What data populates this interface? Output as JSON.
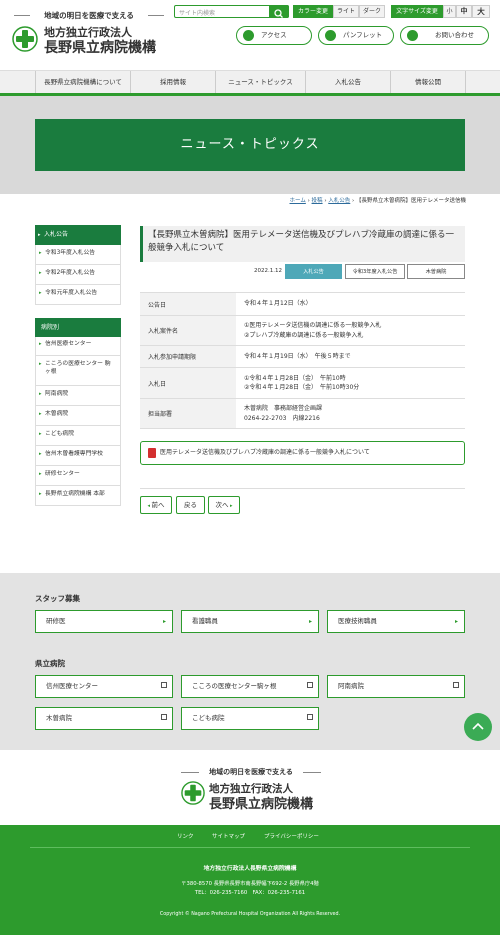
{
  "header": {
    "tagline": "地域の明日を医療で支える",
    "org_line1": "地方独立行政法人",
    "org_line2": "長野県立病院機構",
    "search_placeholder": "サイト内検索",
    "color_label": "カラー変更",
    "color_light": "ライト",
    "color_dark": "ダーク",
    "fontsize_label": "文字サイズ変更",
    "font_small": "小",
    "font_medium": "中",
    "font_large": "大",
    "access": "アクセス",
    "pamphlet": "パンフレット",
    "contact": "お問い合わせ"
  },
  "nav": [
    "長野県立病院機構について",
    "採用情報",
    "ニュース・トピックス",
    "入札公告",
    "情報公開"
  ],
  "hero_title": "ニュース・トピックス",
  "breadcrumb": {
    "home": "ホーム",
    "sep": "›",
    "post": "投稿",
    "bid": "入札公告",
    "current": "【長野県立木曽病院】医用テレメータ送信機"
  },
  "sidebar": {
    "bid_head": "入札公告",
    "bid_items": [
      "令和3年度入札公告",
      "令和2年度入札公告",
      "令和元年度入札公告"
    ],
    "hosp_head": "病院別",
    "hosp_items": [
      "信州医療センター",
      "こころの医療センター 駒ヶ根",
      "阿南病院",
      "木曽病院",
      "こども病院",
      "信州木曽看護専門学校",
      "研修センター",
      "長野県立病院機構 本部"
    ]
  },
  "article": {
    "title": "【長野県立木曽病院】医用テレメータ送信機及びプレハブ冷蔵庫の調達に係る一般競争入札について",
    "date": "2022.1.12",
    "tags": [
      "入札公告",
      "令和3年度入札公告",
      "木曽病院"
    ],
    "rows": [
      {
        "key": "公告日",
        "value": [
          "令和４年１月12日（水）"
        ]
      },
      {
        "key": "入札案件名",
        "value": [
          "①医用テレメータ送信機の調達に係る一般競争入札",
          "②プレハブ冷蔵庫の調達に係る一般競争入札"
        ]
      },
      {
        "key": "入札参加申請期限",
        "value": [
          "令和４年１月19日（水）　午後５時まで"
        ]
      },
      {
        "key": "入札日",
        "value": [
          "①令和４年１月28日（金）　午前10時",
          "②令和４年１月28日（金）　午前10時30分"
        ]
      },
      {
        "key": "担当部署",
        "value": [
          "木曽病院　事務部経営企画課",
          "0264-22-2703　内線2216"
        ]
      }
    ],
    "pdf_link": "医用テレメータ送信機及びプレハブ冷蔵庫の調達に係る一般競争入札について",
    "prev": "前へ",
    "back": "戻る",
    "next": "次へ"
  },
  "staff": {
    "title": "スタッフ募集",
    "items": [
      "研修医",
      "看護職員",
      "医療技術職員"
    ]
  },
  "hospitals": {
    "title": "県立病院",
    "items": [
      "信州医療センター",
      "こころの医療センター駒ヶ根",
      "阿南病院",
      "木曽病院",
      "こども病院"
    ]
  },
  "footer": {
    "links": [
      "リンク",
      "サイトマップ",
      "プライバシーポリシー"
    ],
    "org": "地方独立行政法人長野県立病院機構",
    "address": "〒380-8570 長野県長野市南長野幅下692-2 長野県庁4階",
    "tel": "TEL：026-235-7160　FAX：026-235-7161",
    "copyright": "Copyright © Nagano Prefectural Hospital Organization All Rights Reserved."
  },
  "colors": {
    "brand_green": "#2d9b2d",
    "dark_green": "#1a7c3e",
    "teal_tag": "#4ea8b8"
  }
}
